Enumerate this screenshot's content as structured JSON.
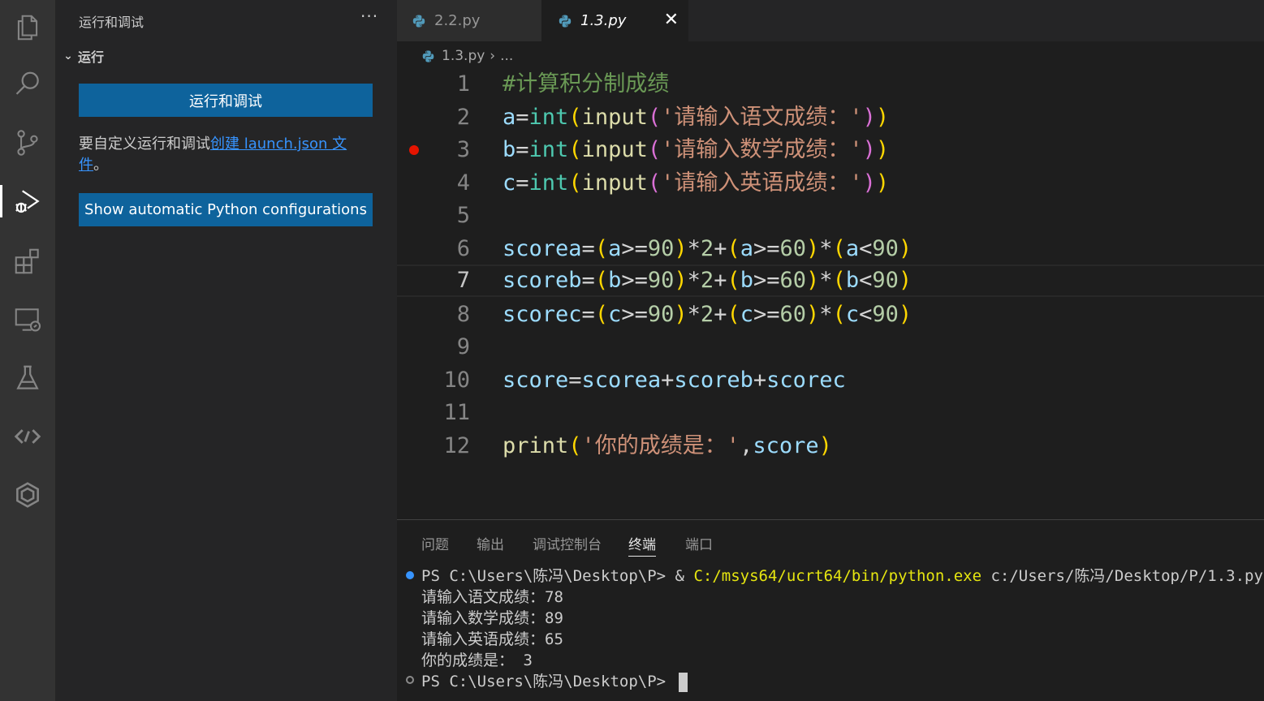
{
  "sidebar": {
    "title": "运行和调试",
    "more": "···",
    "section": "运行",
    "run_button": "运行和调试",
    "hint_prefix": "要自定义运行和调试",
    "hint_link": "创建 launch.json 文件",
    "hint_suffix": "。",
    "python_button": "Show automatic Python configurations"
  },
  "activity_icons": [
    "explorer-icon",
    "search-icon",
    "source-control-icon",
    "run-debug-icon",
    "extensions-icon",
    "remote-explorer-icon",
    "testing-icon",
    "remote-icon",
    "chat-icon"
  ],
  "tabs": [
    {
      "label": "2.2.py",
      "active": false
    },
    {
      "label": "1.3.py",
      "active": true
    }
  ],
  "tab_close": "✕",
  "breadcrumb": {
    "file": "1.3.py",
    "sep": "›",
    "more": "..."
  },
  "editor": {
    "current_line": 7,
    "breakpoint_line": 3,
    "line_numbers": [
      "1",
      "2",
      "3",
      "4",
      "5",
      "6",
      "7",
      "8",
      "9",
      "10",
      "11",
      "12"
    ],
    "lines": [
      "#计算积分制成绩",
      "a=int(input('请输入语文成绩：'))",
      "b=int(input('请输入数学成绩：'))",
      "c=int(input('请输入英语成绩：'))",
      "",
      "scorea=(a>=90)*2+(a>=60)*(a<90)",
      "scoreb=(b>=90)*2+(b>=60)*(b<90)",
      "scorec=(c>=90)*2+(c>=60)*(c<90)",
      "",
      "score=scorea+scoreb+scorec",
      "",
      "print('你的成绩是：',score)"
    ]
  },
  "panel": {
    "tabs": [
      "问题",
      "输出",
      "调试控制台",
      "终端",
      "端口"
    ],
    "active_tab": "终端",
    "terminal": {
      "prompt": "PS C:\\Users\\陈冯\\Desktop\\P> ",
      "cmd_amp": "& ",
      "cmd_exe": "C:/msys64/ucrt64/bin/python.exe",
      "cmd_arg": " c:/Users/陈冯/Desktop/P/1.3.py",
      "outputs": [
        "请输入语文成绩：78",
        "请输入数学成绩：89",
        "请输入英语成绩：65",
        "你的成绩是： 3"
      ],
      "prompt2": "PS C:\\Users\\陈冯\\Desktop\\P> "
    }
  }
}
